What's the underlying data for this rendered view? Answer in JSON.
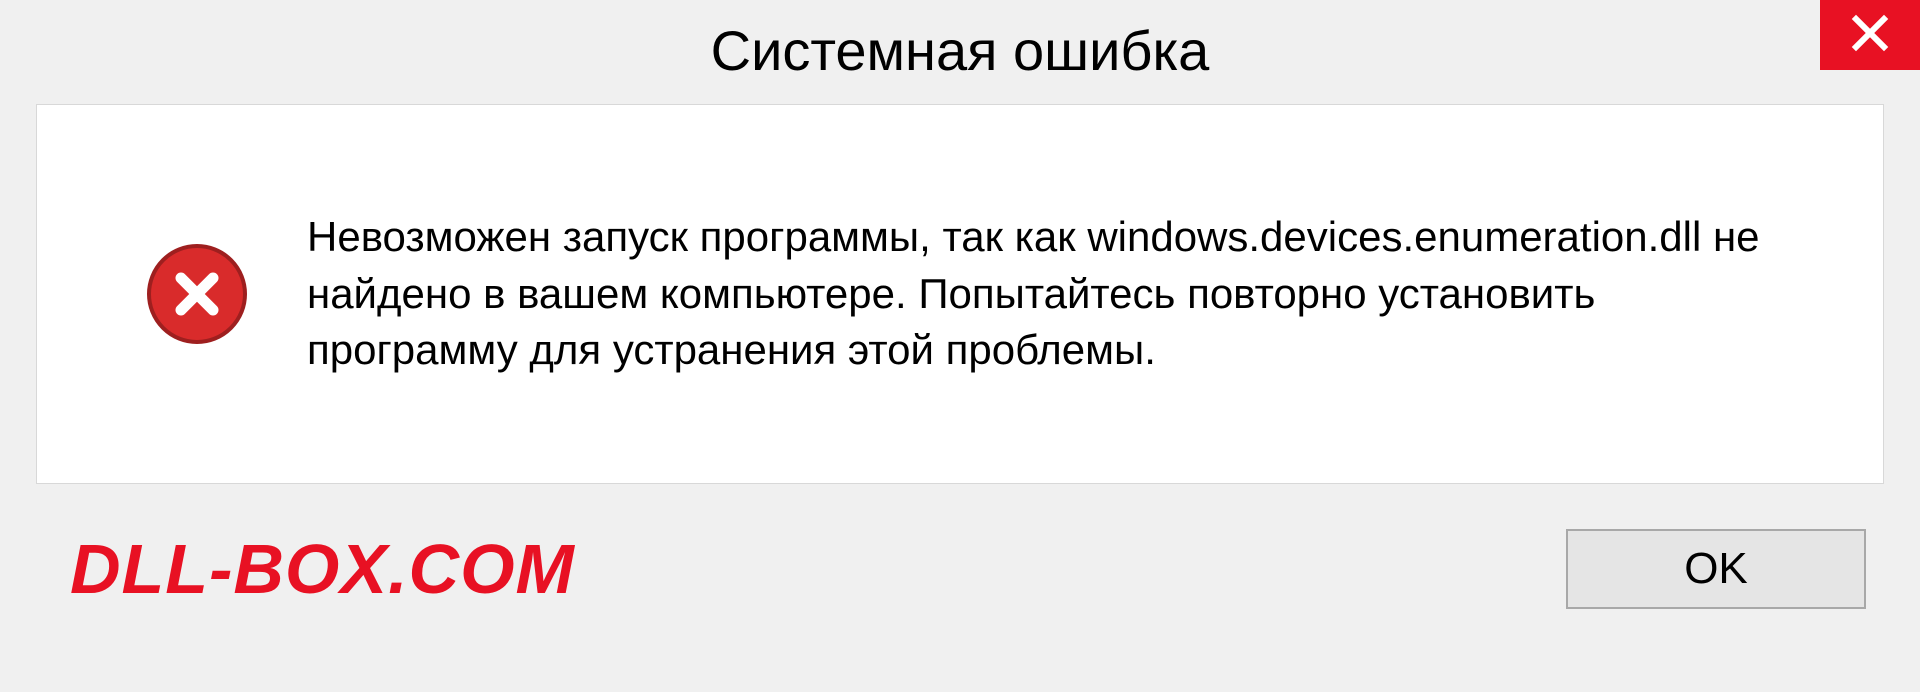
{
  "dialog": {
    "title": "Системная ошибка",
    "message": "Невозможен запуск программы, так как windows.devices.enumeration.dll не найдено в вашем компьютере. Попытайтесь повторно установить программу для устранения этой проблемы.",
    "ok_label": "OK"
  },
  "watermark": {
    "text": "DLL-BOX.COM"
  },
  "icons": {
    "close": "close-icon",
    "error": "error-icon"
  },
  "colors": {
    "close_bg": "#e81123",
    "error_circle": "#d92b2b",
    "watermark": "#e81123",
    "dialog_bg": "#f0f0f0",
    "content_bg": "#ffffff"
  }
}
